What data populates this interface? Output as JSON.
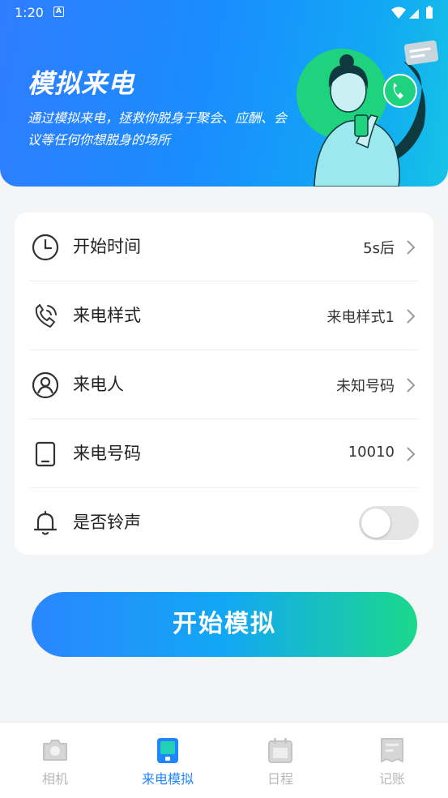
{
  "status_bar": {
    "time": "1:20",
    "notification_icon": "A"
  },
  "hero": {
    "title": "模拟来电",
    "subtitle": "通过模拟来电，拯救你脱身于聚会、应酬、会议等任何你想脱身的场所"
  },
  "settings": {
    "rows": [
      {
        "label": "开始时间",
        "value": "5s后",
        "icon": "clock-icon"
      },
      {
        "label": "来电样式",
        "value": "来电样式1",
        "icon": "phone-call-icon"
      },
      {
        "label": "来电人",
        "value": "未知号码",
        "icon": "person-icon"
      },
      {
        "label": "来电号码",
        "value": "10010",
        "icon": "tablet-icon"
      }
    ],
    "ringtone": {
      "label": "是否铃声",
      "enabled": false,
      "icon": "bell-icon"
    }
  },
  "start_button": {
    "label": "开始模拟"
  },
  "tabbar": {
    "tabs": [
      {
        "label": "相机",
        "icon": "camera-icon",
        "active": false
      },
      {
        "label": "来电模拟",
        "icon": "phone-sim-icon",
        "active": true
      },
      {
        "label": "日程",
        "icon": "calendar-icon",
        "active": false
      },
      {
        "label": "记账",
        "icon": "ledger-icon",
        "active": false
      }
    ]
  },
  "colors": {
    "accent": "#1f86ff",
    "gradient_start": "#2a86ff",
    "gradient_end": "#1bd88c"
  }
}
